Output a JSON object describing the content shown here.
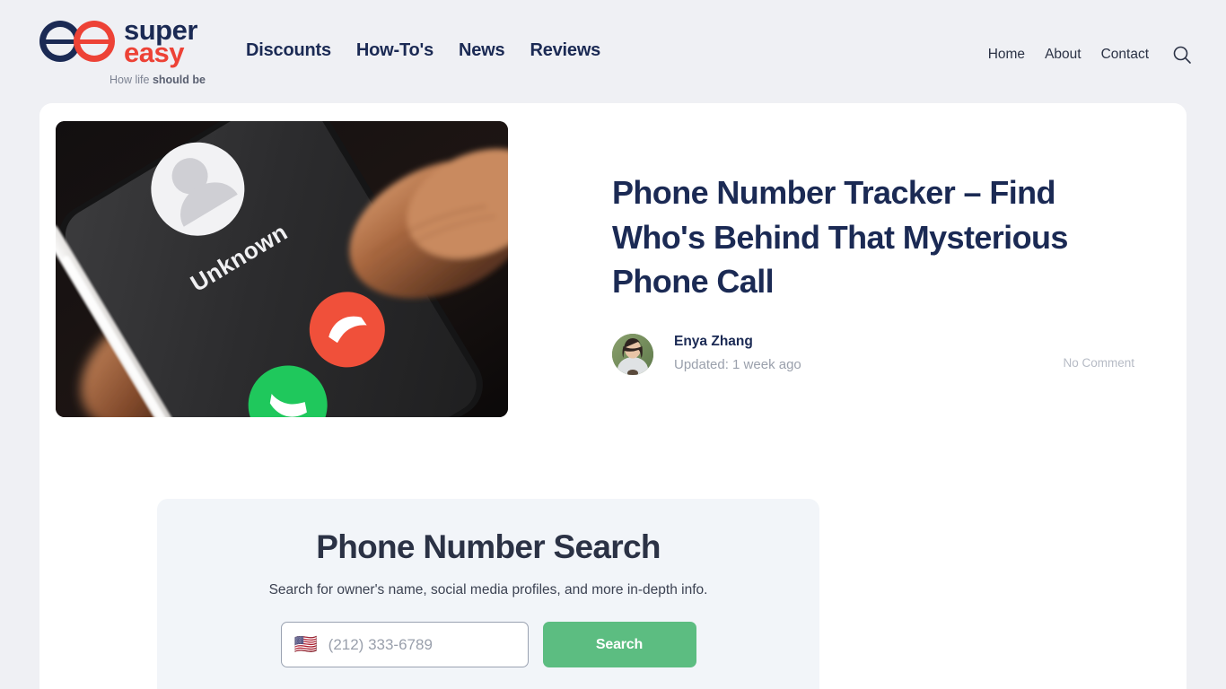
{
  "brand": {
    "name_line1": "super",
    "name_line2": "easy",
    "tagline_regular": "How life ",
    "tagline_bold": "should be",
    "logo_icon": "superreasy-double-e-logo",
    "navy": "#1b2a54",
    "red": "#ed4236"
  },
  "nav": {
    "primary": [
      {
        "label": "Discounts"
      },
      {
        "label": "How-To's"
      },
      {
        "label": "News"
      },
      {
        "label": "Reviews"
      }
    ],
    "utility": [
      {
        "label": "Home"
      },
      {
        "label": "About"
      },
      {
        "label": "Contact"
      }
    ],
    "search_icon": "search-icon"
  },
  "article": {
    "title": "Phone Number Tracker – Find Who's Behind That Mysterious Phone Call",
    "hero_alt": "Hand holding a smartphone showing an incoming call from Unknown with green accept and red decline buttons",
    "hero_screen_label": "Unknown",
    "author": "Enya Zhang",
    "updated": "Updated: 1 week ago",
    "comments": "No Comment"
  },
  "search_panel": {
    "title": "Phone Number Search",
    "subtitle": "Search for owner's name, social media profiles, and more in-depth info.",
    "country_flag": "🇺🇸",
    "phone_placeholder": "(212) 333-6789",
    "phone_value": "",
    "submit_label": "Search",
    "submit_color": "#5cbd81"
  }
}
